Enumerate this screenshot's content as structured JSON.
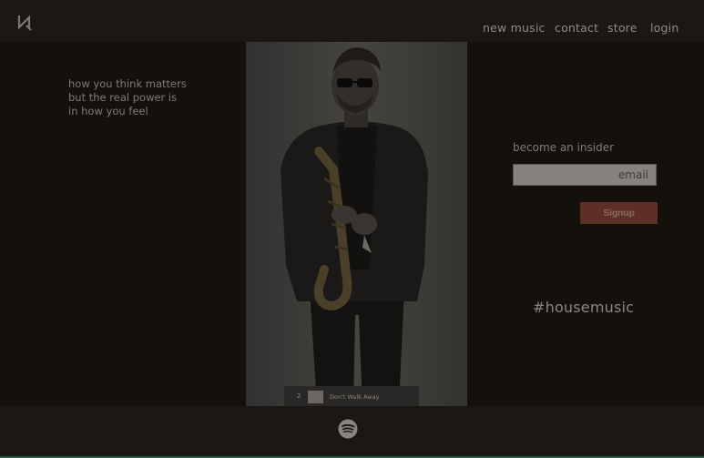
{
  "header": {
    "logo_icon": "n-monogram-icon",
    "nav": [
      {
        "label": "new music"
      },
      {
        "label": "contact"
      },
      {
        "label": "store"
      },
      {
        "label": "login"
      }
    ]
  },
  "quote": {
    "lines": [
      "how you think matters",
      "but the real power is",
      "in how you feel"
    ]
  },
  "insider": {
    "title": "become an insider",
    "email_placeholder": "email",
    "signup_label": "Signup"
  },
  "hashtag": "#housemusic",
  "player": {
    "track_number": "2",
    "track_title": "Don't Walk Away"
  },
  "footer": {
    "icon": "spotify-icon"
  },
  "colors": {
    "background": "#15110d",
    "header": "#1a1714",
    "signup": "#5e2f24",
    "accent_line": "#2a5a47"
  }
}
